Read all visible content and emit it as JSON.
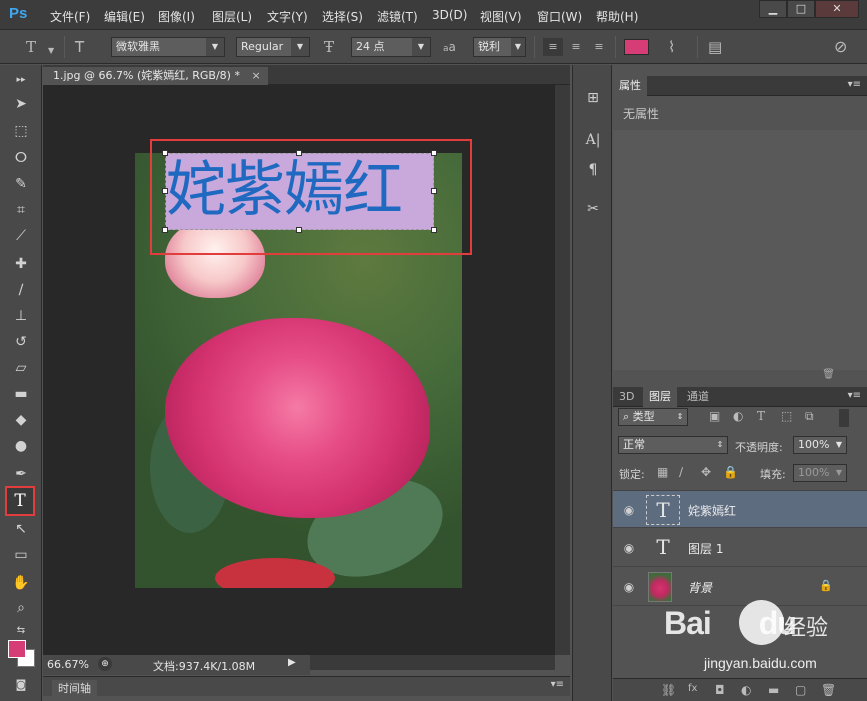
{
  "app": {
    "logo": "Ps",
    "menus": [
      "文件(F)",
      "编辑(E)",
      "图像(I)",
      "图层(L)",
      "文字(Y)",
      "选择(S)",
      "滤镜(T)",
      "3D(D)",
      "视图(V)",
      "窗口(W)",
      "帮助(H)"
    ],
    "window_buttons": [
      "▁",
      "□",
      "✕"
    ]
  },
  "options_bar": {
    "font_family": "微软雅黑",
    "font_style": "Regular",
    "font_size": "24 点",
    "antialias_label": "a",
    "antialias": "锐利",
    "text_color": "#d63c75"
  },
  "document": {
    "tab_title": "1.jpg @ 66.7% (姹紫嫣红, RGB/8) *",
    "canvas_text": "姹紫嫣红",
    "text_color": "#1f6ac0",
    "highlight_color": "#c9a8dc"
  },
  "status": {
    "zoom": "66.67%",
    "doc_size": "文档:937.4K/1.08M"
  },
  "timeline": {
    "label": "时间轴"
  },
  "properties": {
    "title": "属性",
    "empty_text": "无属性"
  },
  "layers_panel": {
    "tabs": [
      "3D",
      "图层",
      "通道"
    ],
    "filter_label": "类型",
    "blend_mode": "正常",
    "opacity_label": "不透明度:",
    "opacity": "100%",
    "lock_label": "锁定:",
    "fill_label": "填充:",
    "fill": "100%",
    "layers": [
      {
        "name": "姹紫嫣红",
        "thumb": "T",
        "selected": true
      },
      {
        "name": "图层 1",
        "thumb": "T",
        "selected": false
      },
      {
        "name": "背景",
        "thumb": "",
        "selected": false,
        "locked": true
      }
    ]
  },
  "watermark": {
    "logo": "Bai",
    "logo_suffix": "du",
    "cn": "经验",
    "url": "jingyan.baidu.com"
  },
  "colors": {
    "foreground": "#d63c75",
    "background": "#ffffff",
    "highlight_box": "#e23d3d"
  }
}
